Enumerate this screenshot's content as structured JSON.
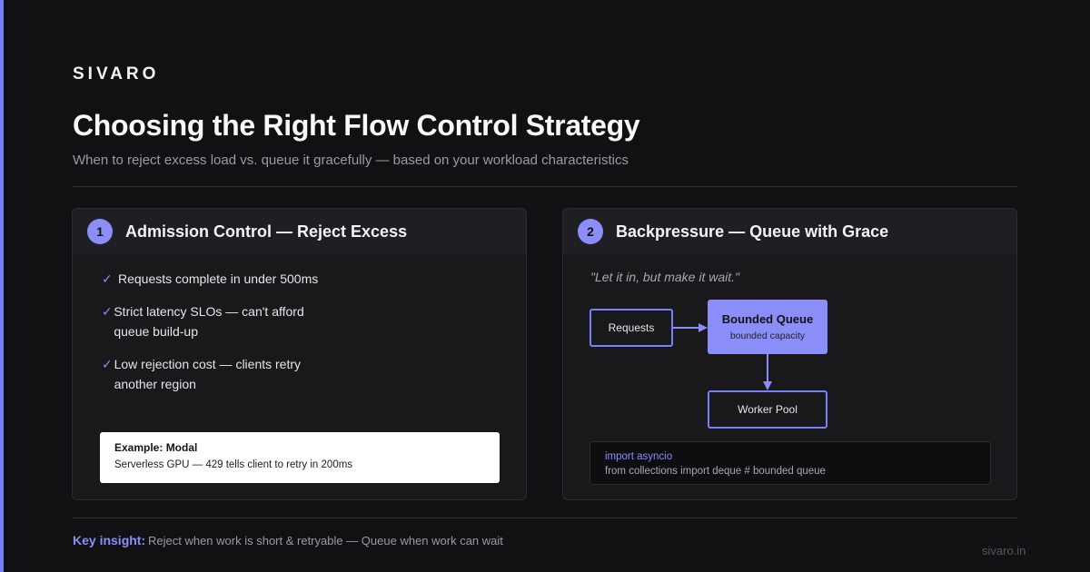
{
  "brand": "SIVARO",
  "title": "Choosing the Right Flow Control Strategy",
  "subtitle": "When to reject excess load vs. queue it gracefully — based on your workload characteristics",
  "left_card": {
    "number": "1",
    "title": "Admission Control — Reject Excess",
    "checks": [
      {
        "mark": "✓",
        "text": "Requests complete in under 500ms"
      },
      {
        "mark": "✓",
        "text": "Strict latency SLOs — can't afford queue build-up"
      },
      {
        "mark": "✓",
        "text": "Low rejection cost — clients retry another region"
      }
    ],
    "example": {
      "title": "Example: Modal",
      "text": "Serverless GPU — 429 tells client to retry in 200ms"
    }
  },
  "right_card": {
    "number": "2",
    "title": "Backpressure — Queue with Grace",
    "quote": "\"Let it in, but make it wait.\"",
    "diagram": {
      "requests": "Requests",
      "queue_title": "Bounded Queue",
      "queue_sub": "bounded capacity",
      "workers": "Worker Pool"
    },
    "code": {
      "line1": "import asyncio",
      "line2": "from collections import deque # bounded queue"
    }
  },
  "insight": {
    "label": "Key insight:",
    "text": "Reject when work is short & retryable — Queue when work can wait"
  },
  "footer_url": "sivaro.in",
  "colors": {
    "accent": "#8b8ef9",
    "background": "#111113",
    "card": "#19191c"
  }
}
